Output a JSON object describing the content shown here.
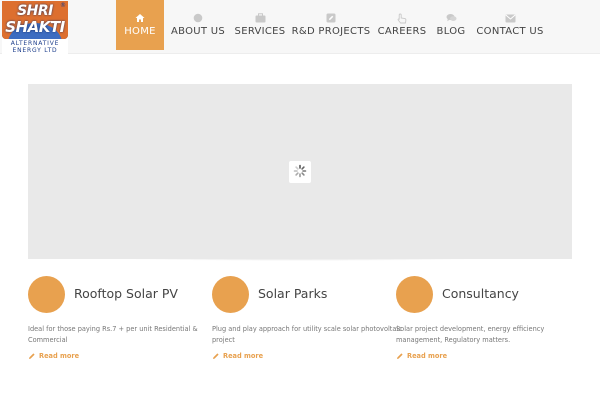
{
  "logo": {
    "line1": "SHRI",
    "line2": "SHAKTI",
    "reg_mark": "®",
    "sub1": "ALTERNATIVE",
    "sub2": "ENERGY LTD"
  },
  "nav": {
    "items": [
      {
        "label": "HOME",
        "icon": "home-icon",
        "active": true
      },
      {
        "label": "ABOUT US",
        "icon": "circle-icon",
        "active": false
      },
      {
        "label": "SERVICES",
        "icon": "briefcase-icon",
        "active": false
      },
      {
        "label": "R&D PROJECTS",
        "icon": "edit-icon",
        "active": false
      },
      {
        "label": "CAREERS",
        "icon": "hand-pointer-icon",
        "active": false
      },
      {
        "label": "BLOG",
        "icon": "comments-icon",
        "active": false
      },
      {
        "label": "CONTACT US",
        "icon": "envelope-icon",
        "active": false
      }
    ]
  },
  "slider": {
    "loader_icon": "spinner-icon"
  },
  "features": [
    {
      "title": "Rooftop Solar PV",
      "description": "Ideal for those paying Rs.7 + per unit Residential & Commercial",
      "link": "Read more"
    },
    {
      "title": "Solar Parks",
      "description": "Plug and play approach for utility scale solar photovoltaic project",
      "link": "Read more"
    },
    {
      "title": "Consultancy",
      "description": "Solar project development, energy efficiency management, Regulatory matters.",
      "link": "Read more"
    }
  ],
  "colors": {
    "accent": "#e8a14f",
    "header_bg": "#f7f7f7",
    "slider_bg": "#e9e9e9",
    "nav_icon": "#c9c9c9"
  }
}
